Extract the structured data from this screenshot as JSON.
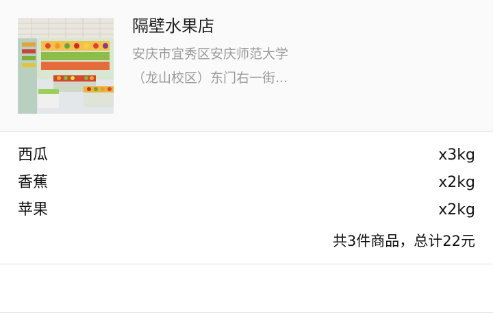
{
  "shop": {
    "name": "隔壁水果店",
    "address_line1": "安庆市宜秀区安庆师范大学",
    "address_line2": "（龙山校区）东门右一街..."
  },
  "order": {
    "items": [
      {
        "name": "西瓜",
        "qty": "x3kg"
      },
      {
        "name": "香蕉",
        "qty": "x2kg"
      },
      {
        "name": "苹果",
        "qty": "x2kg"
      }
    ],
    "summary": "共3件商品，总计22元"
  }
}
